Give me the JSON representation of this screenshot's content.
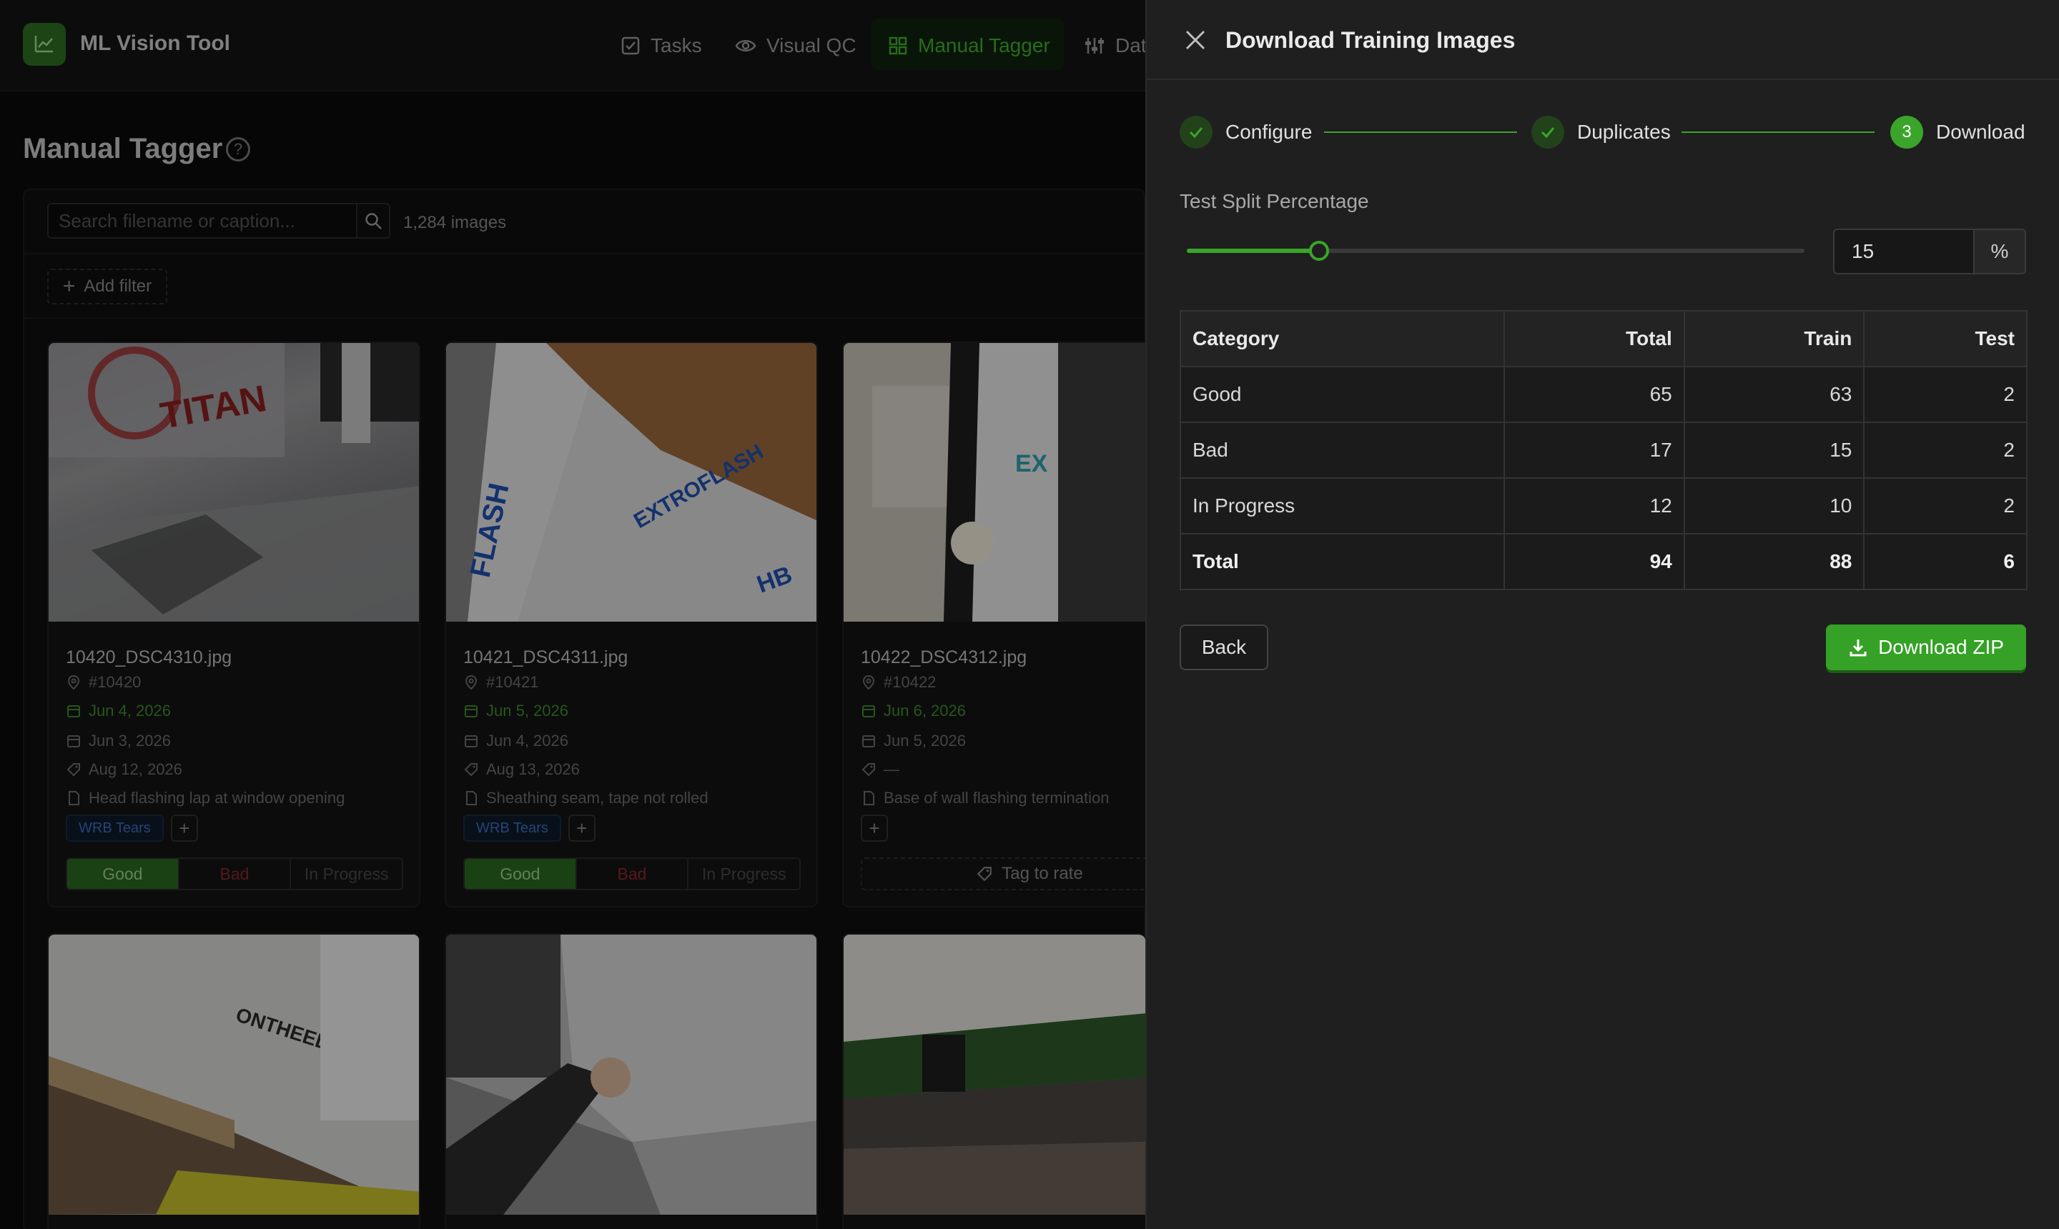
{
  "app": {
    "title": "ML Vision Tool",
    "colors": {
      "accent": "#3aa52a",
      "bad": "#8a2a2a",
      "tag": "#3e6ec0"
    }
  },
  "nav": [
    {
      "label": "Tasks",
      "icon": "checkbox-icon"
    },
    {
      "label": "Visual QC",
      "icon": "eye-icon"
    },
    {
      "label": "Manual Tagger",
      "icon": "grid-icon",
      "active": true
    },
    {
      "label": "Dat",
      "icon": "sliders-icon"
    }
  ],
  "page": {
    "title": "Manual Tagger",
    "search_placeholder": "Search filename or caption...",
    "image_count": "1,284 images",
    "add_filter": "Add filter"
  },
  "cards": [
    {
      "filename": "10420_DSC4310.jpg",
      "id": "#10420",
      "date_green": "Jun 4, 2026",
      "date2": "Jun 3, 2026",
      "date3": "Aug 12, 2026",
      "caption": "Head flashing lap at window opening",
      "tag": "WRB Tears",
      "rating": [
        "Good",
        "Bad",
        "In Progress"
      ]
    },
    {
      "filename": "10421_DSC4311.jpg",
      "id": "#10421",
      "date_green": "Jun 5, 2026",
      "date2": "Jun 4, 2026",
      "date3": "Aug 13, 2026",
      "caption": "Sheathing seam, tape not rolled",
      "tag": "WRB Tears",
      "rating": [
        "Good",
        "Bad",
        "In Progress"
      ]
    },
    {
      "filename": "10422_DSC4312.jpg",
      "id": "#10422",
      "date_green": "Jun 6, 2026",
      "date2": "Jun 5, 2026",
      "date3": "—",
      "caption": "Base of wall flashing termination",
      "tag_to_rate": "Tag to rate"
    }
  ],
  "drawer": {
    "title": "Download Training Images",
    "steps": [
      {
        "label": "Configure",
        "state": "done"
      },
      {
        "label": "Duplicates",
        "state": "done"
      },
      {
        "label": "Download",
        "number": "3",
        "state": "current"
      }
    ],
    "split_label": "Test Split Percentage",
    "split_value": 15,
    "split_value_text": "15",
    "split_suffix": "%",
    "table": {
      "headers": [
        "Category",
        "Total",
        "Train",
        "Test"
      ],
      "rows": [
        [
          "Good",
          "65",
          "63",
          "2"
        ],
        [
          "Bad",
          "17",
          "15",
          "2"
        ],
        [
          "In Progress",
          "12",
          "10",
          "2"
        ]
      ],
      "total": [
        "Total",
        "94",
        "88",
        "6"
      ]
    },
    "back_label": "Back",
    "download_label": "Download ZIP"
  }
}
